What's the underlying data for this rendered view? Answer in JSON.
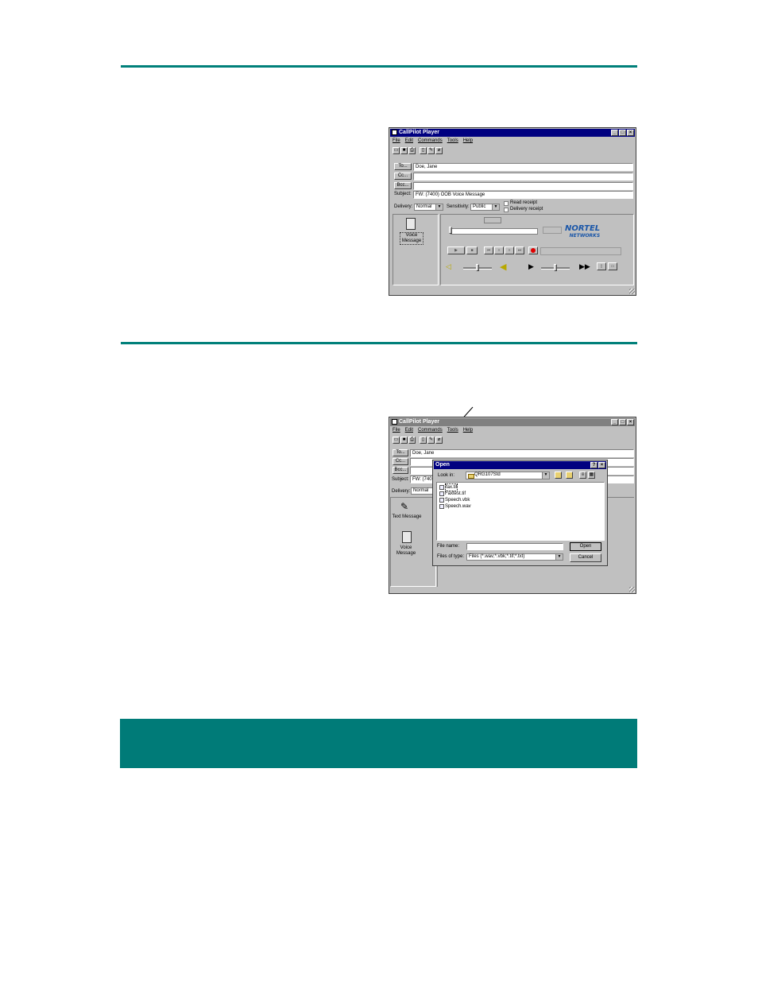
{
  "top_window": {
    "title": "CallPilot Player",
    "menu": [
      "File",
      "Edit",
      "Commands",
      "Tools",
      "Help"
    ],
    "title_buttons": [
      "_",
      "□",
      "×"
    ],
    "to_button": "To...",
    "cc_button": "Cc...",
    "bcc_button": "Bcc...",
    "to_value": "Doe, Jane",
    "subject_label": "Subject:",
    "subject_value": "FW: (7400) OOB Voice Message",
    "delivery_label": "Delivery:",
    "delivery_value": "Normal",
    "sensitivity_label": "Sensitivity:",
    "sensitivity_value": "Public",
    "read_receipt": "Read receipt",
    "delivery_receipt": "Delivery receipt",
    "voice_message": "Voice Message",
    "logo_main": "NORTEL",
    "logo_sub": "NETWORKS"
  },
  "bottom_window": {
    "title": "CallPilot Player",
    "menu": [
      "File",
      "Edit",
      "Commands",
      "Tools",
      "Help"
    ],
    "to_button": "To...",
    "cc_button": "Cc...",
    "bcc_button": "Bcc...",
    "to_value": "Doe, Jane",
    "subject_label": "Subject:",
    "subject_value": "FW: (740",
    "delivery_label": "Delivery:",
    "delivery_value": "Normal",
    "text_message": "Text Message",
    "voice_message": "Voice Message"
  },
  "open_dialog": {
    "title": "Open",
    "look_in_label": "Look in:",
    "look_in_value": "QRG107Std",
    "files": [
      "fax.tif",
      "Faxtest.tif",
      "Speech.vbk",
      "Speech.wav"
    ],
    "file_name_label": "File name:",
    "file_name_value": "",
    "files_of_type_label": "Files of type:",
    "files_of_type_value": "Files (*.wav;*.vbk;*.tif;*.txt)",
    "open_button": "Open",
    "cancel_button": "Cancel"
  },
  "colors": {
    "accent": "#00807a",
    "titlebar": "#000080",
    "record": "#e00000"
  }
}
